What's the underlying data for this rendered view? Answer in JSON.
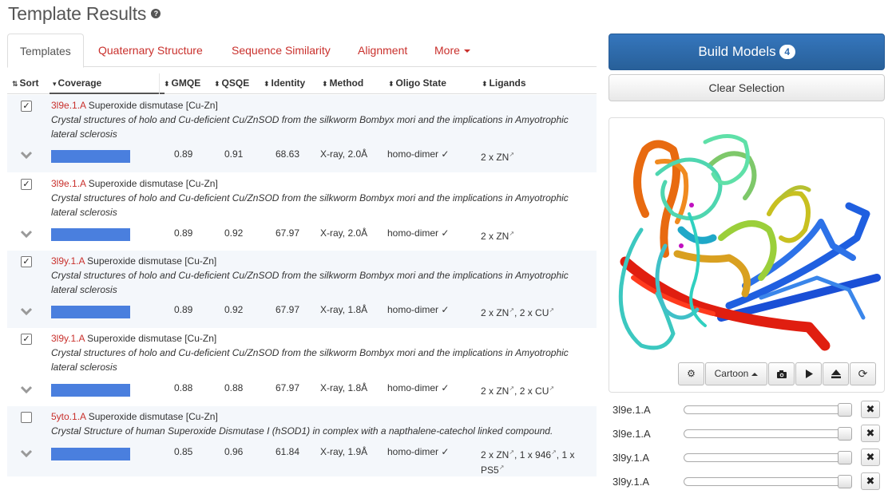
{
  "page": {
    "title": "Template Results",
    "help_symbol": "?"
  },
  "tabs": [
    "Templates",
    "Quaternary Structure",
    "Sequence Similarity",
    "Alignment",
    "More"
  ],
  "columns": {
    "sort": "Sort",
    "coverage": "Coverage",
    "gmqe": "GMQE",
    "qsqe": "QSQE",
    "identity": "Identity",
    "method": "Method",
    "oligo": "Oligo State",
    "ligands": "Ligands"
  },
  "templates": [
    {
      "checked": true,
      "id": "3l9e.1.A",
      "name": "Superoxide dismutase [Cu-Zn]",
      "description": "Crystal structures of holo and Cu-deficient Cu/ZnSOD from the silkworm Bombyx mori and the implications in Amyotrophic lateral sclerosis",
      "coverage": 1.0,
      "gmqe": "0.89",
      "qsqe": "0.91",
      "identity": "68.63",
      "method": "X-ray, 2.0Å",
      "oligo": "homo-dimer ✓",
      "ligands": [
        "2 x ZN"
      ]
    },
    {
      "checked": true,
      "id": "3l9e.1.A",
      "name": "Superoxide dismutase [Cu-Zn]",
      "description": "Crystal structures of holo and Cu-deficient Cu/ZnSOD from the silkworm Bombyx mori and the implications in Amyotrophic lateral sclerosis",
      "coverage": 1.0,
      "gmqe": "0.89",
      "qsqe": "0.92",
      "identity": "67.97",
      "method": "X-ray, 2.0Å",
      "oligo": "homo-dimer ✓",
      "ligands": [
        "2 x ZN"
      ]
    },
    {
      "checked": true,
      "id": "3l9y.1.A",
      "name": "Superoxide dismutase [Cu-Zn]",
      "description": "Crystal structures of holo and Cu-deficient Cu/ZnSOD from the silkworm Bombyx mori and the implications in Amyotrophic lateral sclerosis",
      "coverage": 1.0,
      "gmqe": "0.89",
      "qsqe": "0.92",
      "identity": "67.97",
      "method": "X-ray, 1.8Å",
      "oligo": "homo-dimer ✓",
      "ligands": [
        "2 x ZN",
        "2 x CU"
      ]
    },
    {
      "checked": true,
      "id": "3l9y.1.A",
      "name": "Superoxide dismutase [Cu-Zn]",
      "description": "Crystal structures of holo and Cu-deficient Cu/ZnSOD from the silkworm Bombyx mori and the implications in Amyotrophic lateral sclerosis",
      "coverage": 1.0,
      "gmqe": "0.88",
      "qsqe": "0.88",
      "identity": "67.97",
      "method": "X-ray, 1.8Å",
      "oligo": "homo-dimer ✓",
      "ligands": [
        "2 x ZN",
        "2 x CU"
      ]
    },
    {
      "checked": false,
      "id": "5yto.1.A",
      "name": "Superoxide dismutase [Cu-Zn]",
      "description": "Crystal Structure of human Superoxide Dismutase I (hSOD1) in complex with a napthalene-catechol linked compound.",
      "coverage": 1.0,
      "gmqe": "0.85",
      "qsqe": "0.96",
      "identity": "61.84",
      "method": "X-ray, 1.9Å",
      "oligo": "homo-dimer ✓",
      "ligands": [
        "2 x ZN",
        "1 x 946",
        "1 x PS5"
      ]
    }
  ],
  "build": {
    "label": "Build Models",
    "count": "4"
  },
  "clear_label": "Clear Selection",
  "viewer": {
    "style_label": "Cartoon"
  },
  "selected_models": [
    "3l9e.1.A",
    "3l9e.1.A",
    "3l9y.1.A",
    "3l9y.1.A"
  ],
  "colors": {
    "accent_red": "#c9302c",
    "primary_blue": "#2f6bb0",
    "coverage_blue": "#4a7fde"
  }
}
